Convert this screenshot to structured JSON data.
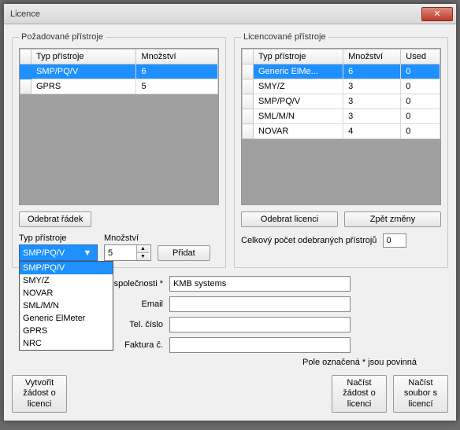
{
  "window": {
    "title": "Licence"
  },
  "left": {
    "legend": "Požadované přístroje",
    "cols": [
      "Typ přístroje",
      "Množství"
    ],
    "rows": [
      {
        "type": "SMP/PQ/V",
        "qty": "6",
        "sel": true
      },
      {
        "type": "GPRS",
        "qty": "5",
        "sel": false
      }
    ],
    "remove_btn": "Odebrat řádek",
    "type_label": "Typ přístroje",
    "qty_label": "Množství",
    "combo_selected": "SMP/PQ/V",
    "combo_options": [
      "SMP/PQ/V",
      "SMY/Z",
      "NOVAR",
      "SML/M/N",
      "Generic ElMeter",
      "GPRS",
      "NRC"
    ],
    "spinner_value": "5",
    "add_btn": "Přidat"
  },
  "right": {
    "legend": "Licencované přístroje",
    "cols": [
      "Typ přístroje",
      "Množství",
      "Used"
    ],
    "rows": [
      {
        "type": "Generic ElMe...",
        "qty": "6",
        "used": "0",
        "sel": true
      },
      {
        "type": "SMY/Z",
        "qty": "3",
        "used": "0",
        "sel": false
      },
      {
        "type": "SMP/PQ/V",
        "qty": "3",
        "used": "0",
        "sel": false
      },
      {
        "type": "SML/M/N",
        "qty": "3",
        "used": "0",
        "sel": false
      },
      {
        "type": "NOVAR",
        "qty": "4",
        "used": "0",
        "sel": false
      }
    ],
    "remove_btn": "Odebrat licenci",
    "revert_btn": "Zpět změny",
    "total_label": "Celkový počet odebraných přístrojů",
    "total_value": "0"
  },
  "form": {
    "company_label": "Název společnosti *",
    "company_value": "KMB systems",
    "email_label": "Email",
    "email_value": "",
    "phone_label": "Tel. číslo",
    "phone_value": "",
    "invoice_label": "Faktura č.",
    "invoice_value": "",
    "note": "Pole označená * jsou povinná"
  },
  "footer": {
    "create_btn": "Vytvořit žádost o licenci",
    "load_req_btn": "Načíst žádost o licenci",
    "load_file_btn": "Načíst soubor s licencí"
  }
}
